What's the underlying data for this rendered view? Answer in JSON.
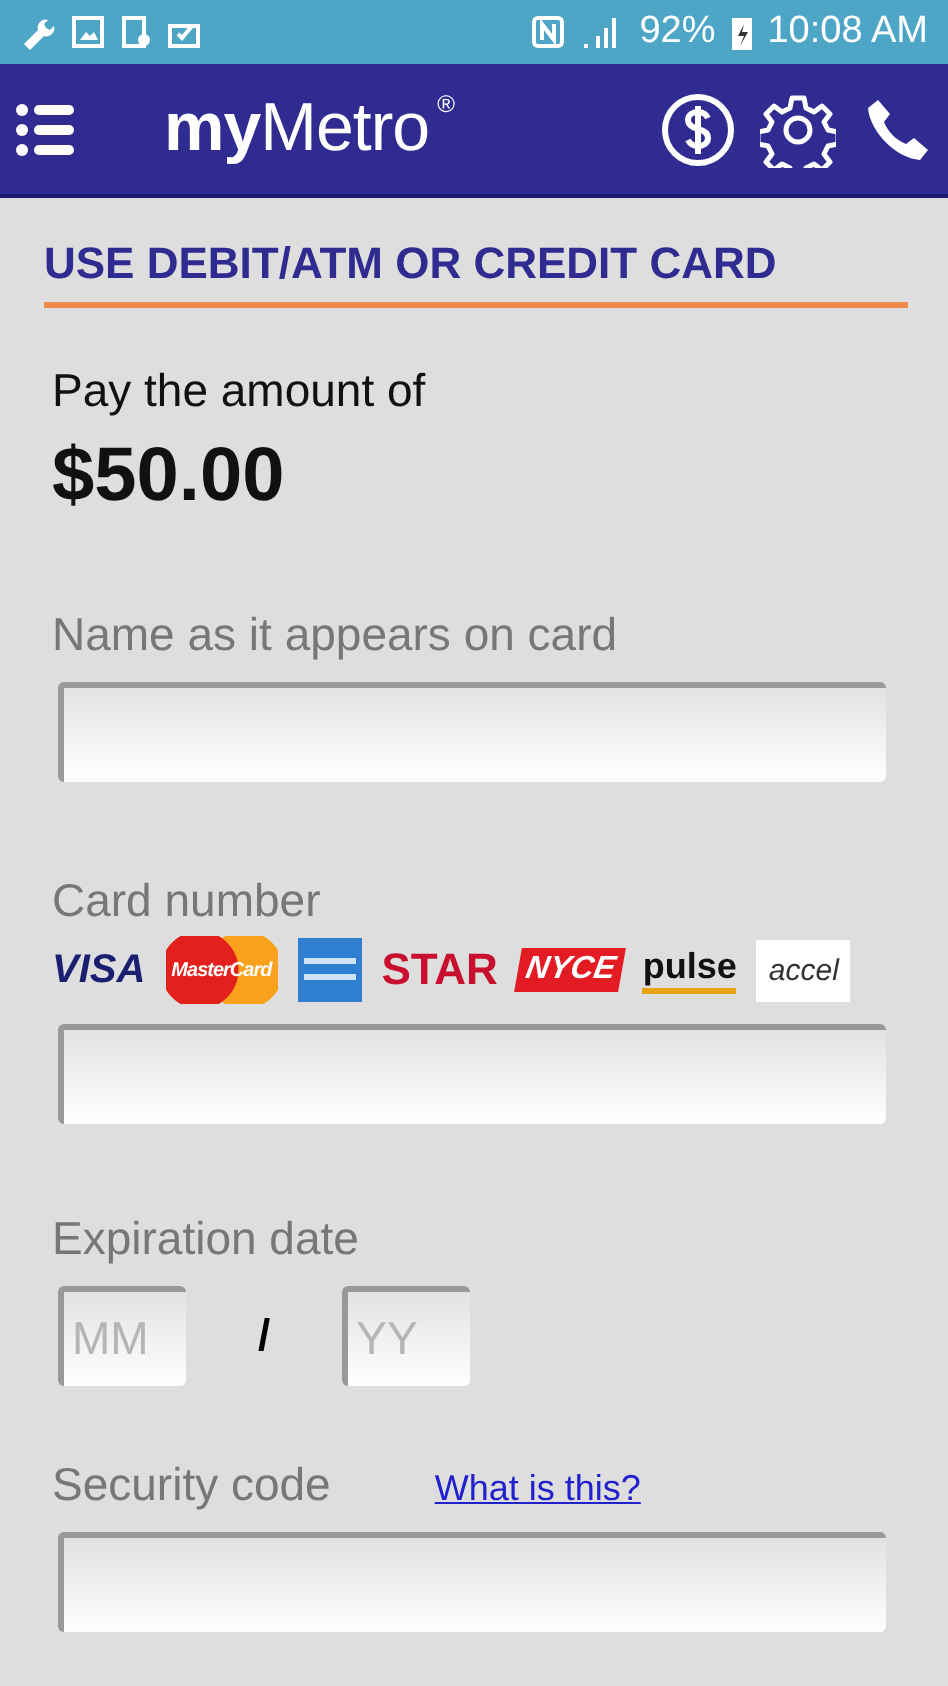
{
  "status_bar": {
    "battery": "92%",
    "time": "10:08 AM"
  },
  "header": {
    "brand": "**my**Metro$^{®}$"
  },
  "section_title": "USE DEBIT/ATM OR CREDIT CARD",
  "amount": {
    "label": "Pay the amount of",
    "value": "$50.00"
  },
  "fields": [
    {
      "label": "Name as it appears on card"
    },
    {
      "label": "Card number",
      "card_logos": [
        {
          "kind": "visa",
          "label": "VISA"
        },
        {
          "kind": "mastercard",
          "label": "MasterCard"
        },
        {
          "kind": "amex"
        },
        {
          "kind": "star",
          "label": "STAR"
        },
        {
          "kind": "nyce",
          "label": "NYCE"
        },
        {
          "kind": "pulse",
          "label": "pulse"
        },
        {
          "kind": "accel",
          "label": "accel"
        }
      ]
    }
  ],
  "expiration": {
    "label": "Expiration date",
    "month_placeholder": "MM",
    "separator": "/",
    "year_placeholder": "YY"
  },
  "security": {
    "label": "Security code",
    "link": "What is this?"
  }
}
